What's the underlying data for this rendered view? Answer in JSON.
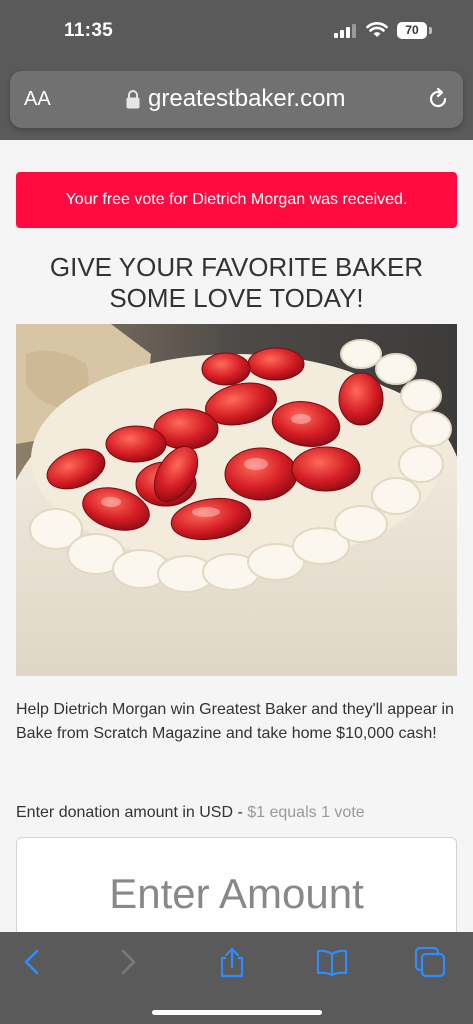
{
  "status_bar": {
    "time": "11:35",
    "battery": "70"
  },
  "browser": {
    "aa_label": "AA",
    "url": "greatestbaker.com",
    "accent_color": "#2f8cff"
  },
  "alert": {
    "text": "Your free vote for Dietrich Morgan was received.",
    "color": "#ff0a41"
  },
  "headline": {
    "line1": "GIVE YOUR FAVORITE BAKER",
    "line2": "SOME LOVE TODAY!"
  },
  "photo": {
    "description_icon": "strawberry-cake-photo"
  },
  "description": "Help Dietrich Morgan win Greatest Baker and they'll appear in Bake from Scratch Magazine and take home $10,000 cash!",
  "donation": {
    "label": "Enter donation amount in USD - ",
    "hint": "$1 equals 1 vote",
    "placeholder": "Enter Amount"
  },
  "toolbar": {
    "icons": [
      "back-icon",
      "forward-icon",
      "share-icon",
      "bookmarks-icon",
      "tabs-icon"
    ]
  }
}
